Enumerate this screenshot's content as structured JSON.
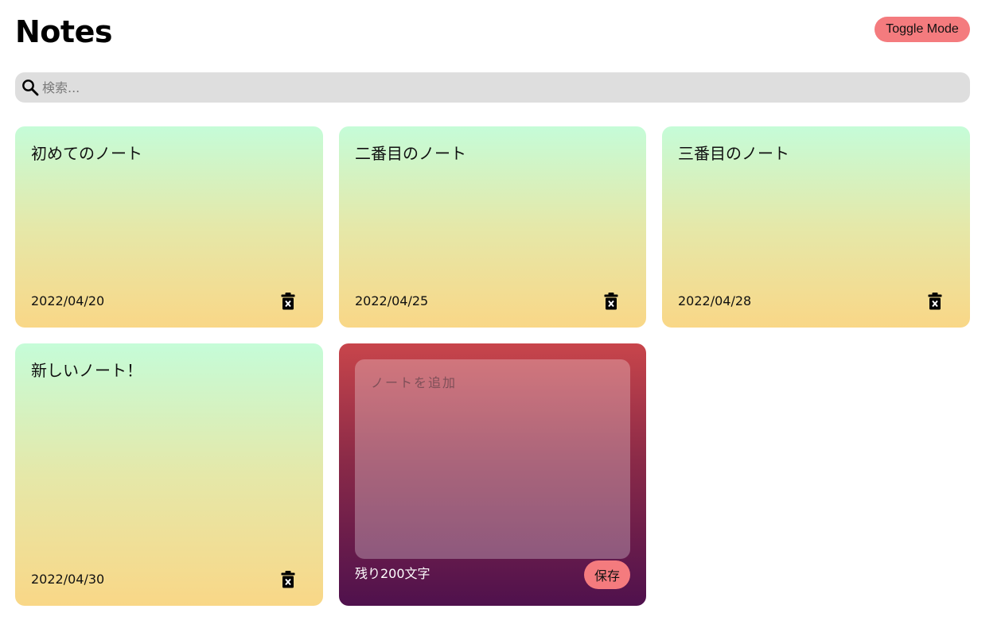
{
  "header": {
    "title": "Notes",
    "toggle_label": "Toggle Mode"
  },
  "search": {
    "placeholder": "検索...",
    "icon": "search-icon"
  },
  "notes": [
    {
      "text": "初めてのノート",
      "date": "2022/04/20"
    },
    {
      "text": "二番目のノート",
      "date": "2022/04/25"
    },
    {
      "text": "三番目のノート",
      "date": "2022/04/28"
    },
    {
      "text": "新しいノート！",
      "date": "2022/04/30"
    }
  ],
  "new_note": {
    "placeholder": "ノートを追加",
    "remaining": "残り200文字",
    "save_label": "保存"
  },
  "colors": {
    "accent": "#f47b7e",
    "note_gradient_top": "#c5fcd8",
    "note_gradient_bottom": "#f9d787",
    "new_note_gradient_top": "#c8454b",
    "new_note_gradient_bottom": "#4f114d",
    "search_bg": "#dedede"
  }
}
